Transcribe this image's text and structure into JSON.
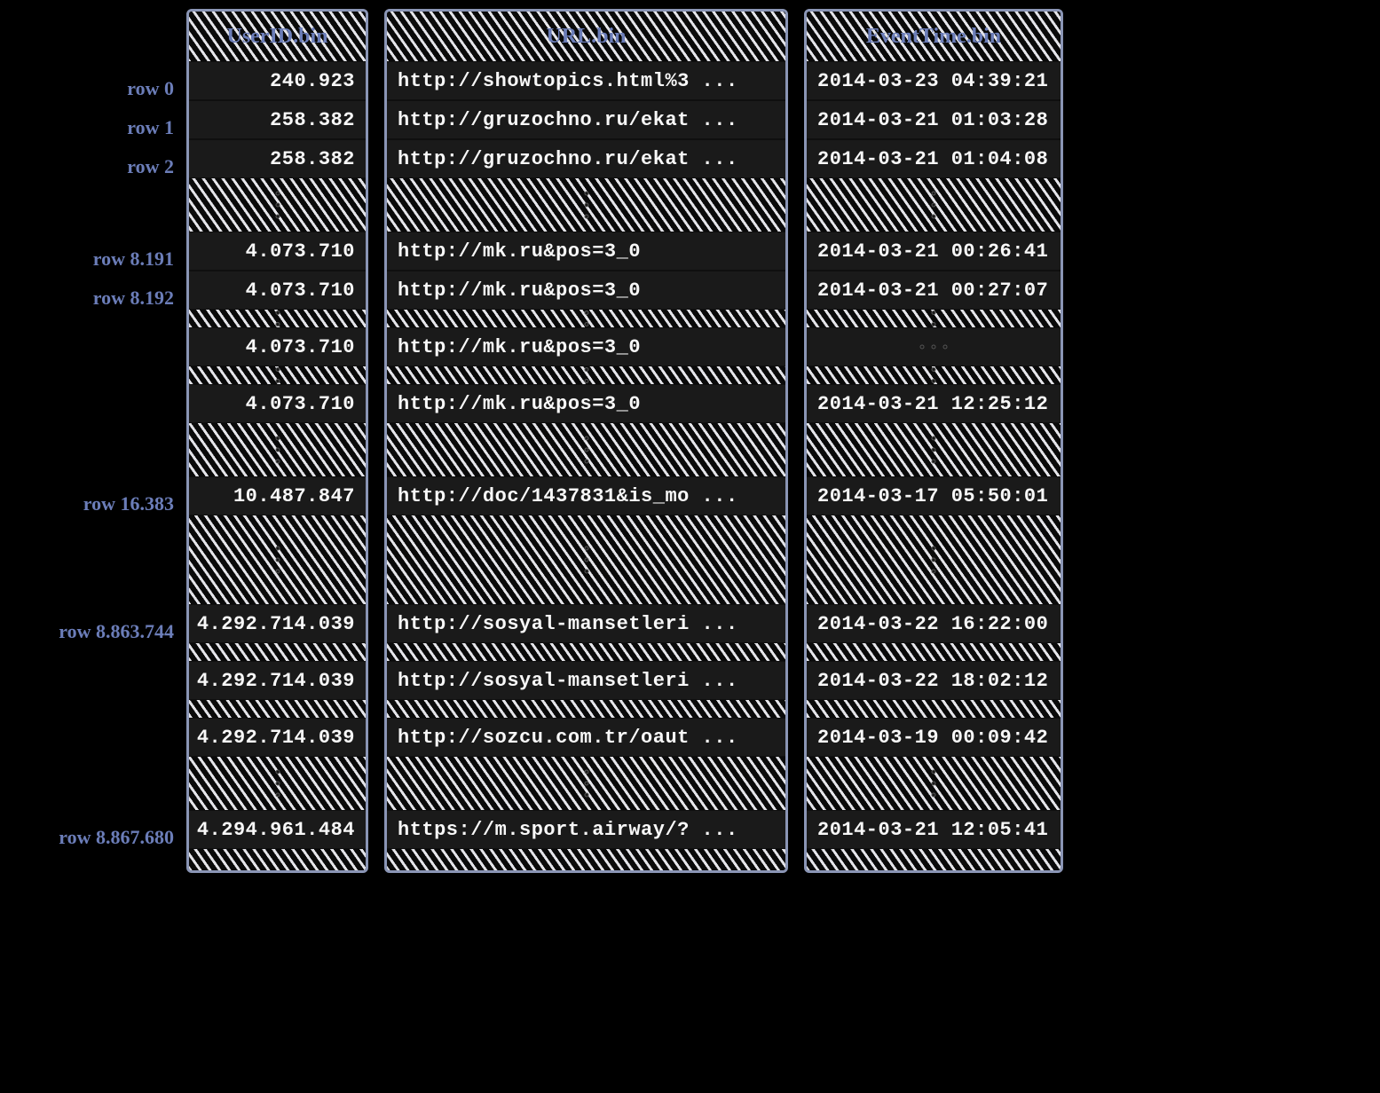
{
  "columns": {
    "userid": {
      "header": "UserID.bin"
    },
    "url": {
      "header": "URL.bin"
    },
    "time": {
      "header": "EventTime.bin"
    }
  },
  "row_labels": {
    "r0": "row 0",
    "r1": "row 1",
    "r2": "row 2",
    "r8191": "row 8.191",
    "r8192": "row 8.192",
    "r16383": "row 16.383",
    "r8863744": "row 8.863.744",
    "r8867680": "row 8.867.680"
  },
  "cells": {
    "userid": {
      "r0": "240.923",
      "r1": "258.382",
      "r2": "258.382",
      "r8191": "4.073.710",
      "r8192": "4.073.710",
      "r8193": "4.073.710",
      "r8194": "4.073.710",
      "r16383": "10.487.847",
      "r8863744": "4.292.714.039",
      "r8863745": "4.292.714.039",
      "r8863746": "4.292.714.039",
      "r8867680": "4.294.961.484"
    },
    "url": {
      "r0": "http://showtopics.html%3 ...",
      "r1": "http://gruzochno.ru/ekat ...",
      "r2": "http://gruzochno.ru/ekat ...",
      "r8191": "http://mk.ru&pos=3_0",
      "r8192": "http://mk.ru&pos=3_0",
      "r8193": "http://mk.ru&pos=3_0",
      "r8194": "http://mk.ru&pos=3_0",
      "r16383": "http://doc/1437831&is_mo ...",
      "r8863744": "http://sosyal-mansetleri ...",
      "r8863745": "http://sosyal-mansetleri ...",
      "r8863746": "http://sozcu.com.tr/oaut ...",
      "r8867680": "https://m.sport.airway/? ..."
    },
    "time": {
      "r0": "2014-03-23 04:39:21",
      "r1": "2014-03-21 01:03:28",
      "r2": "2014-03-21 01:04:08",
      "r8191": "2014-03-21 00:26:41",
      "r8192": "2014-03-21 00:27:07",
      "r8193": "",
      "r8194": "2014-03-21 12:25:12",
      "r16383": "2014-03-17 05:50:01",
      "r8863744": "2014-03-22 16:22:00",
      "r8863745": "2014-03-22 18:02:12",
      "r8863746": "2014-03-19 00:09:42",
      "r8867680": "2014-03-21 12:05:41"
    }
  }
}
